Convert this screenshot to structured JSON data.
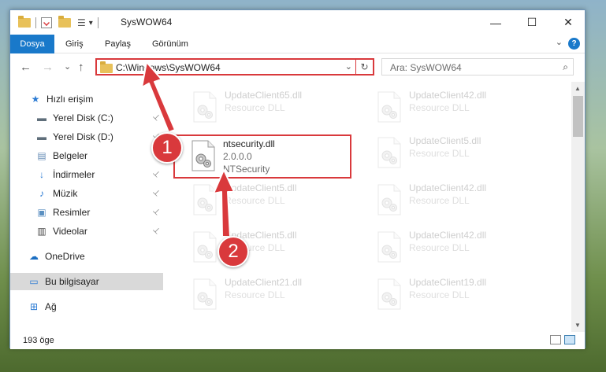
{
  "window": {
    "title": "SysWOW64",
    "minimize_glyph": "—",
    "maximize_glyph": "☐",
    "close_glyph": "✕"
  },
  "ribbon": {
    "tabs": [
      {
        "label": "Dosya",
        "active": true
      },
      {
        "label": "Giriş",
        "active": false
      },
      {
        "label": "Paylaş",
        "active": false
      },
      {
        "label": "Görünüm",
        "active": false
      }
    ],
    "help_glyph": "?",
    "collapse_glyph": "⌄"
  },
  "nav": {
    "back_glyph": "←",
    "forward_glyph": "→",
    "recent_glyph": "⌄",
    "up_glyph": "↑",
    "address": "C:\\Windows\\SysWOW64",
    "address_dropdown_glyph": "⌄",
    "refresh_glyph": "↻",
    "search_placeholder": "Ara: SysWOW64",
    "search_glyph": "⌕"
  },
  "sidebar": {
    "items": [
      {
        "label": "Hızlı erişim",
        "icon": "star-icon",
        "glyph": "★",
        "color": "#2a7ad3",
        "pinned": false
      },
      {
        "label": "Yerel Disk (C:)",
        "icon": "drive-icon",
        "glyph": "▬",
        "color": "#5f6e7a",
        "pinned": true
      },
      {
        "label": "Yerel Disk (D:)",
        "icon": "drive-icon",
        "glyph": "▬",
        "color": "#5f6e7a",
        "pinned": true
      },
      {
        "label": "Belgeler",
        "icon": "documents-icon",
        "glyph": "▤",
        "color": "#6a8fb7",
        "pinned": true
      },
      {
        "label": "İndirmeler",
        "icon": "downloads-icon",
        "glyph": "↓",
        "color": "#2a7ad3",
        "pinned": true
      },
      {
        "label": "Müzik",
        "icon": "music-icon",
        "glyph": "♪",
        "color": "#2a7ad3",
        "pinned": true
      },
      {
        "label": "Resimler",
        "icon": "pictures-icon",
        "glyph": "▣",
        "color": "#5a8fc0",
        "pinned": true
      },
      {
        "label": "Videolar",
        "icon": "videos-icon",
        "glyph": "▥",
        "color": "#4a4a4a",
        "pinned": true
      },
      {
        "label": "OneDrive",
        "icon": "cloud-icon",
        "glyph": "☁",
        "color": "#1b6ec2",
        "pinned": false
      },
      {
        "label": "Bu bilgisayar",
        "icon": "computer-icon",
        "glyph": "▭",
        "color": "#2a7ad3",
        "pinned": false
      },
      {
        "label": "Ağ",
        "icon": "network-icon",
        "glyph": "⊞",
        "color": "#2a7ad3",
        "pinned": false
      }
    ],
    "pin_glyph": "📌"
  },
  "files": {
    "highlighted": {
      "name": "ntsecurity.dll",
      "version": "2.0.0.0",
      "description": "NTSecurity"
    },
    "faded": [
      {
        "name": "UpdateClient65.dll",
        "description": "Resource DLL"
      },
      {
        "name": "UpdateClient42.dll",
        "description": "Resource DLL"
      },
      {
        "name": "UpdateClient5.dll",
        "description": "Resource DLL"
      },
      {
        "name": "UpdateClient5.dll",
        "description": "Resource DLL"
      },
      {
        "name": "UpdateClient42.dll",
        "description": "Resource DLL"
      },
      {
        "name": "UpdateClient5.dll",
        "description": "Resource DLL"
      },
      {
        "name": "UpdateClient42.dll",
        "description": "Resource DLL"
      },
      {
        "name": "UpdateClient21.dll",
        "description": "Resource DLL"
      },
      {
        "name": "UpdateClient19.dll",
        "description": "Resource DLL"
      }
    ]
  },
  "status": {
    "item_count": "193 öge"
  },
  "annotations": {
    "step1": "1",
    "step2": "2",
    "color": "#d9393c"
  }
}
